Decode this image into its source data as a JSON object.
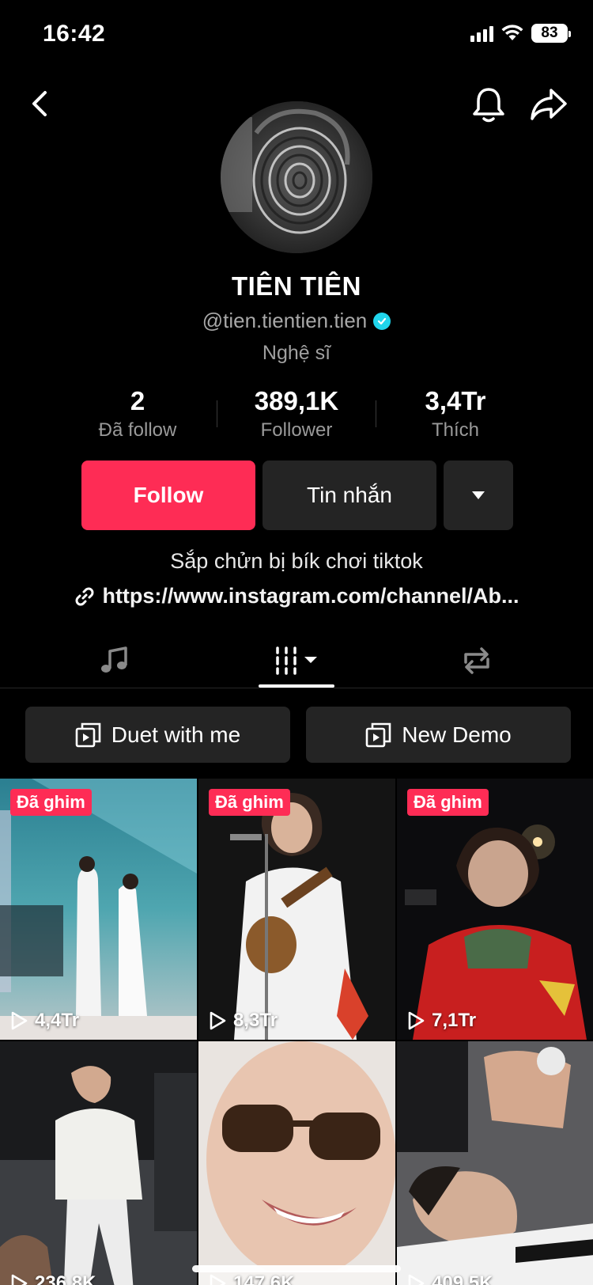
{
  "status": {
    "time": "16:42",
    "battery": "83"
  },
  "profile": {
    "name": "TIÊN TIÊN",
    "handle": "@tien.tientien.tien",
    "category": "Nghệ sĩ",
    "bio": "Sắp chửn bị bík chơi tiktok",
    "link": "https://www.instagram.com/channel/Ab..."
  },
  "stats": [
    {
      "value": "2",
      "label": "Đã follow"
    },
    {
      "value": "389,1K",
      "label": "Follower"
    },
    {
      "value": "3,4Tr",
      "label": "Thích"
    }
  ],
  "actions": {
    "follow": "Follow",
    "message": "Tin nhắn"
  },
  "tabs": [
    "music-icon",
    "videos-grid-icon",
    "repost-icon"
  ],
  "playlists": [
    {
      "label": "Duet with me"
    },
    {
      "label": "New Demo"
    }
  ],
  "videos": [
    {
      "pinned": true,
      "pin_label": "Đã ghim",
      "views": "4,4Tr"
    },
    {
      "pinned": true,
      "pin_label": "Đã ghim",
      "views": "8,3Tr"
    },
    {
      "pinned": true,
      "pin_label": "Đã ghim",
      "views": "7,1Tr"
    },
    {
      "pinned": false,
      "views": "236,8K"
    },
    {
      "pinned": false,
      "views": "147,6K"
    },
    {
      "pinned": false,
      "views": "409,5K"
    }
  ],
  "colors": {
    "accent": "#fe2c55",
    "verified": "#20d5ec",
    "button_dark": "#242424"
  }
}
